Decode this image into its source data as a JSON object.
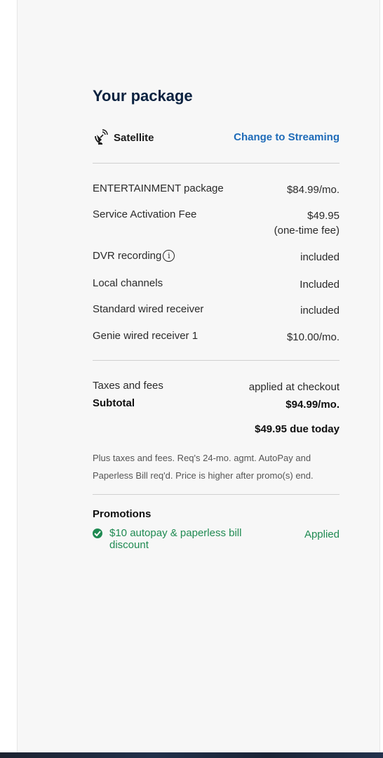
{
  "package": {
    "title": "Your package",
    "service_type": "Satellite",
    "change_link": "Change to Streaming"
  },
  "line_items": [
    {
      "label": "ENTERTAINMENT package",
      "value": "$84.99/mo."
    },
    {
      "label": "Service Activation Fee",
      "value": "$49.95",
      "value_note": "(one-time fee)"
    },
    {
      "label": "DVR recording",
      "value": "included",
      "info_icon": "info-icon"
    },
    {
      "label": "Local channels",
      "value": "Included"
    },
    {
      "label": "Standard wired receiver",
      "value": "included"
    },
    {
      "label": "Genie wired receiver 1",
      "value": "$10.00/mo."
    }
  ],
  "totals": {
    "taxes_label": "Taxes and fees",
    "taxes_value": "applied at checkout",
    "subtotal_label": "Subtotal",
    "subtotal_value": "$94.99/mo.",
    "due_today": "$49.95 due today"
  },
  "disclaimer": "Plus taxes and fees. Req's 24-mo. agmt. AutoPay and Paperless Bill req'd. Price is higher after promo(s) end.",
  "promotions": {
    "title": "Promotions",
    "items": [
      {
        "label": "$10 autopay & paperless bill discount",
        "status": "Applied",
        "icon": "check-circle-icon"
      }
    ]
  },
  "colors": {
    "title": "#0a2240",
    "link": "#1e6bb8",
    "promo": "#1f8a52",
    "panel_bg": "#f7f7f7"
  }
}
